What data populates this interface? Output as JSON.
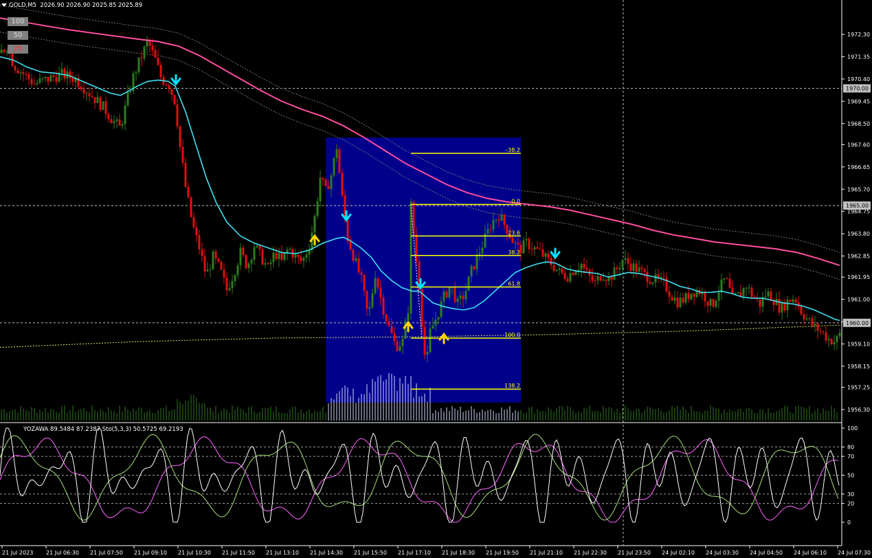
{
  "header": {
    "symbol_timeframe": "GOLD,M5",
    "ohlc": "2026.90 2026.90 2025.85 2025.89"
  },
  "buttons": [
    {
      "label": "100",
      "color": "#d9d9d9"
    },
    {
      "label": "50",
      "color": "#d9d9d9"
    },
    {
      "label": "25",
      "color": "#ff3030"
    }
  ],
  "indicator": {
    "title": "YOZAWA 89.5484 87.2387 Sto(5,3,3) 50.5725 69.2193"
  },
  "colors": {
    "background": "#000000",
    "bull_candle": "#2e7d1e",
    "bear_candle": "#e01010",
    "fast_ma": "#40e0f0",
    "slow_ma": "#ff4fa0",
    "highlight_rect": "#00008b",
    "fib_line": "#ffff00",
    "up_arrow": "#ffd700",
    "down_arrow": "#00e5ff"
  },
  "chart_data": [
    {
      "type": "candlestick",
      "symbol": "GOLD",
      "timeframe": "M5",
      "ylim": [
        1956.3,
        1973.3
      ],
      "price_ticks": [
        "1972.30",
        "1971.35",
        "1970.40",
        "1969.45",
        "1968.50",
        "1967.60",
        "1966.65",
        "1965.70",
        "1964.75",
        "1963.80",
        "1962.85",
        "1961.95",
        "1961.00",
        "1960.05",
        "1959.10",
        "1958.15",
        "1957.25",
        "1956.30"
      ],
      "highlighted_levels": [
        "1970.00",
        "1965.00",
        "1960.00"
      ],
      "time_labels": [
        "21 Jul 2023",
        "21 Jul 06:30",
        "21 Jul 07:50",
        "21 Jul 09:10",
        "21 Jul 10:30",
        "21 Jul 11:50",
        "21 Jul 13:10",
        "21 Jul 14:30",
        "21 Jul 15:50",
        "21 Jul 17:10",
        "21 Jul 18:30",
        "21 Jul 19:50",
        "21 Jul 21:10",
        "21 Jul 22:30",
        "21 Jul 23:50",
        "24 Jul 02:10",
        "24 Jul 03:30",
        "24 Jul 04:50",
        "24 Jul 06:10",
        "24 Jul 07:30"
      ],
      "price_path": [
        [
          0,
          1971.5
        ],
        [
          10,
          1971.8
        ],
        [
          20,
          1971.0
        ],
        [
          35,
          1970.6
        ],
        [
          50,
          1970.2
        ],
        [
          70,
          1970.4
        ],
        [
          90,
          1970.6
        ],
        [
          110,
          1970.4
        ],
        [
          130,
          1969.8
        ],
        [
          150,
          1969.2
        ],
        [
          165,
          1968.6
        ],
        [
          175,
          1968.3
        ],
        [
          185,
          1969.5
        ],
        [
          195,
          1970.6
        ],
        [
          205,
          1971.3
        ],
        [
          215,
          1972.0
        ],
        [
          225,
          1971.3
        ],
        [
          235,
          1970.4
        ],
        [
          245,
          1970.2
        ],
        [
          255,
          1969.4
        ],
        [
          262,
          1967.5
        ],
        [
          270,
          1965.8
        ],
        [
          280,
          1964.2
        ],
        [
          290,
          1963.2
        ],
        [
          300,
          1962.0
        ],
        [
          310,
          1962.8
        ],
        [
          320,
          1962.3
        ],
        [
          330,
          1961.4
        ],
        [
          340,
          1962.1
        ],
        [
          350,
          1963.0
        ],
        [
          360,
          1962.4
        ],
        [
          370,
          1963.3
        ],
        [
          380,
          1962.8
        ],
        [
          390,
          1962.3
        ],
        [
          400,
          1963.0
        ],
        [
          410,
          1962.6
        ],
        [
          420,
          1963.2
        ],
        [
          430,
          1962.8
        ],
        [
          440,
          1962.6
        ],
        [
          450,
          1963.3
        ],
        [
          458,
          1964.5
        ],
        [
          466,
          1966.2
        ],
        [
          474,
          1965.6
        ],
        [
          482,
          1966.3
        ],
        [
          490,
          1967.5
        ],
        [
          498,
          1965.3
        ],
        [
          506,
          1963.6
        ],
        [
          516,
          1962.7
        ],
        [
          526,
          1961.8
        ],
        [
          536,
          1960.2
        ],
        [
          546,
          1962.1
        ],
        [
          556,
          1960.8
        ],
        [
          566,
          1959.8
        ],
        [
          576,
          1959.0
        ],
        [
          586,
          1959.2
        ],
        [
          594,
          1960.6
        ],
        [
          598,
          1965.0
        ],
        [
          604,
          1963.2
        ],
        [
          610,
          1961.6
        ],
        [
          616,
          1959.3
        ],
        [
          620,
          1958.0
        ],
        [
          626,
          1959.6
        ],
        [
          636,
          1960.3
        ],
        [
          646,
          1961.1
        ],
        [
          656,
          1961.6
        ],
        [
          666,
          1960.8
        ],
        [
          676,
          1961.2
        ],
        [
          686,
          1962.2
        ],
        [
          696,
          1962.9
        ],
        [
          706,
          1963.6
        ],
        [
          716,
          1964.3
        ],
        [
          726,
          1964.6
        ],
        [
          736,
          1964.1
        ],
        [
          746,
          1963.5
        ],
        [
          756,
          1963.1
        ],
        [
          766,
          1963.4
        ],
        [
          776,
          1963.2
        ],
        [
          786,
          1963.0
        ],
        [
          796,
          1962.7
        ],
        [
          806,
          1962.4
        ],
        [
          816,
          1962.1
        ],
        [
          826,
          1962.0
        ],
        [
          836,
          1962.3
        ],
        [
          846,
          1962.5
        ],
        [
          856,
          1962.0
        ],
        [
          866,
          1961.7
        ],
        [
          876,
          1962.1
        ],
        [
          886,
          1961.9
        ],
        [
          896,
          1962.2
        ],
        [
          906,
          1962.7
        ],
        [
          916,
          1962.5
        ],
        [
          926,
          1962.3
        ],
        [
          936,
          1962.1
        ],
        [
          946,
          1961.9
        ],
        [
          956,
          1961.8
        ],
        [
          966,
          1961.7
        ],
        [
          976,
          1961.2
        ],
        [
          986,
          1960.9
        ],
        [
          996,
          1961.0
        ],
        [
          1006,
          1961.3
        ],
        [
          1016,
          1961.4
        ],
        [
          1026,
          1961.1
        ],
        [
          1036,
          1960.7
        ],
        [
          1046,
          1961.4
        ],
        [
          1056,
          1961.9
        ],
        [
          1066,
          1961.0
        ],
        [
          1076,
          1961.2
        ],
        [
          1086,
          1961.6
        ],
        [
          1096,
          1961.1
        ],
        [
          1106,
          1960.8
        ],
        [
          1116,
          1961.3
        ],
        [
          1126,
          1961.0
        ],
        [
          1136,
          1960.6
        ],
        [
          1146,
          1960.9
        ],
        [
          1156,
          1961.1
        ],
        [
          1166,
          1960.5
        ],
        [
          1176,
          1960.1
        ],
        [
          1186,
          1959.8
        ],
        [
          1196,
          1959.6
        ],
        [
          1206,
          1959.3
        ],
        [
          1216,
          1959.2
        ],
        [
          1222,
          1959.5
        ]
      ],
      "fast_ma": [
        [
          0,
          1971.35
        ],
        [
          20,
          1971.2
        ],
        [
          40,
          1970.9
        ],
        [
          60,
          1970.7
        ],
        [
          80,
          1970.65
        ],
        [
          100,
          1970.55
        ],
        [
          120,
          1970.3
        ],
        [
          140,
          1970.05
        ],
        [
          160,
          1969.8
        ],
        [
          175,
          1969.7
        ],
        [
          185,
          1969.85
        ],
        [
          200,
          1970.1
        ],
        [
          215,
          1970.3
        ],
        [
          230,
          1970.35
        ],
        [
          245,
          1970.3
        ],
        [
          255,
          1970.1
        ],
        [
          270,
          1969.0
        ],
        [
          285,
          1967.6
        ],
        [
          300,
          1966.2
        ],
        [
          315,
          1965.1
        ],
        [
          330,
          1964.3
        ],
        [
          350,
          1963.7
        ],
        [
          370,
          1963.4
        ],
        [
          390,
          1963.2
        ],
        [
          410,
          1963.0
        ],
        [
          430,
          1962.95
        ],
        [
          450,
          1963.1
        ],
        [
          470,
          1963.4
        ],
        [
          490,
          1963.6
        ],
        [
          500,
          1963.65
        ],
        [
          510,
          1963.5
        ],
        [
          525,
          1963.2
        ],
        [
          540,
          1962.8
        ],
        [
          555,
          1962.2
        ],
        [
          570,
          1961.8
        ],
        [
          585,
          1961.5
        ],
        [
          600,
          1961.35
        ],
        [
          610,
          1961.35
        ],
        [
          620,
          1961.1
        ],
        [
          630,
          1960.85
        ],
        [
          645,
          1960.7
        ],
        [
          660,
          1960.6
        ],
        [
          675,
          1960.55
        ],
        [
          690,
          1960.65
        ],
        [
          705,
          1960.95
        ],
        [
          720,
          1961.35
        ],
        [
          735,
          1961.75
        ],
        [
          750,
          1962.15
        ],
        [
          765,
          1962.35
        ],
        [
          780,
          1962.5
        ],
        [
          795,
          1962.6
        ],
        [
          808,
          1962.55
        ],
        [
          825,
          1962.3
        ],
        [
          840,
          1962.2
        ],
        [
          855,
          1962.15
        ],
        [
          870,
          1962.1
        ],
        [
          885,
          1961.95
        ],
        [
          900,
          1962.05
        ],
        [
          915,
          1962.15
        ],
        [
          930,
          1962.1
        ],
        [
          945,
          1962.0
        ],
        [
          960,
          1961.9
        ],
        [
          975,
          1961.75
        ],
        [
          990,
          1961.55
        ],
        [
          1005,
          1961.45
        ],
        [
          1020,
          1961.3
        ],
        [
          1035,
          1961.3
        ],
        [
          1050,
          1961.35
        ],
        [
          1065,
          1961.25
        ],
        [
          1080,
          1961.1
        ],
        [
          1095,
          1961.05
        ],
        [
          1110,
          1961.05
        ],
        [
          1125,
          1960.95
        ],
        [
          1140,
          1960.85
        ],
        [
          1155,
          1960.8
        ],
        [
          1170,
          1960.7
        ],
        [
          1185,
          1960.55
        ],
        [
          1200,
          1960.35
        ],
        [
          1215,
          1960.15
        ],
        [
          1222,
          1960.1
        ]
      ],
      "slow_ma": [
        [
          0,
          1973.0
        ],
        [
          50,
          1972.75
        ],
        [
          100,
          1972.5
        ],
        [
          150,
          1972.3
        ],
        [
          200,
          1972.1
        ],
        [
          230,
          1972.0
        ],
        [
          260,
          1971.8
        ],
        [
          290,
          1971.4
        ],
        [
          320,
          1970.9
        ],
        [
          350,
          1970.4
        ],
        [
          380,
          1969.9
        ],
        [
          410,
          1969.45
        ],
        [
          440,
          1969.1
        ],
        [
          470,
          1968.8
        ],
        [
          500,
          1968.4
        ],
        [
          530,
          1967.9
        ],
        [
          560,
          1967.35
        ],
        [
          590,
          1966.8
        ],
        [
          620,
          1966.35
        ],
        [
          650,
          1965.9
        ],
        [
          680,
          1965.55
        ],
        [
          710,
          1965.3
        ],
        [
          740,
          1965.15
        ],
        [
          770,
          1965.05
        ],
        [
          800,
          1964.95
        ],
        [
          830,
          1964.8
        ],
        [
          860,
          1964.6
        ],
        [
          890,
          1964.4
        ],
        [
          920,
          1964.2
        ],
        [
          950,
          1963.95
        ],
        [
          980,
          1963.75
        ],
        [
          1010,
          1963.6
        ],
        [
          1040,
          1963.45
        ],
        [
          1070,
          1963.35
        ],
        [
          1100,
          1963.25
        ],
        [
          1130,
          1963.15
        ],
        [
          1160,
          1963.0
        ],
        [
          1190,
          1962.75
        ],
        [
          1222,
          1962.45
        ]
      ],
      "long_ma": [
        [
          0,
          1958.95
        ],
        [
          200,
          1959.2
        ],
        [
          400,
          1959.35
        ],
        [
          600,
          1959.4
        ],
        [
          800,
          1959.5
        ],
        [
          1000,
          1959.65
        ],
        [
          1222,
          1959.9
        ]
      ],
      "rectangle": {
        "x_from": 474,
        "x_to": 758,
        "price_from": 1967.9,
        "price_to": 1956.6
      },
      "fibonacci": {
        "x_from": 598,
        "x_to": 758,
        "price_0": 1965.05,
        "price_100": 1959.35,
        "levels": [
          "-38.2",
          "0.0",
          "23.6",
          "38.2",
          "61.8",
          "100.0",
          "138.2"
        ]
      },
      "up_arrows": [
        [
          458,
          1963.6
        ],
        [
          594,
          1959.9
        ],
        [
          646,
          1959.4
        ]
      ],
      "down_arrows": [
        [
          256,
          1970.3
        ],
        [
          504,
          1964.5
        ],
        [
          612,
          1961.6
        ],
        [
          808,
          1962.9
        ]
      ],
      "volume_max": 70
    },
    {
      "type": "line",
      "title": "YOZAWA 89.5484 87.2387 Sto(5,3,3) 50.5725 69.2193",
      "ylim": [
        0,
        100
      ],
      "levels": [
        100,
        80,
        70,
        50,
        30,
        20,
        0
      ],
      "series": [
        {
          "name": "",
          "color": "#ff66ff"
        },
        {
          "name": "",
          "color": "#a6e07a"
        },
        {
          "name": "",
          "color": "#ffffff"
        }
      ]
    }
  ]
}
